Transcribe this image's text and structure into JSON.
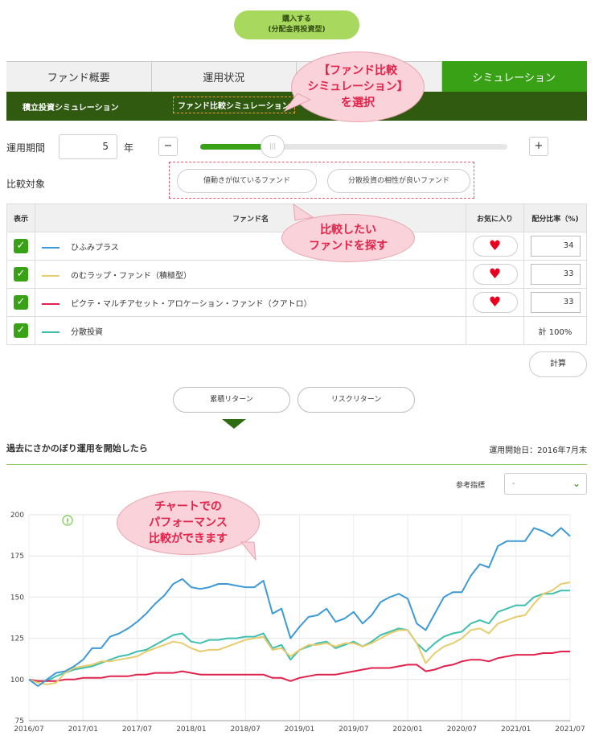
{
  "buy_button": {
    "line1": "購入する",
    "line2": "(分配金再投資型)"
  },
  "tabs": [
    {
      "label": "ファンド概要",
      "active": false
    },
    {
      "label": "運用状況",
      "active": false
    },
    {
      "label": "",
      "active": false
    },
    {
      "label": "シミュレーション",
      "active": true
    }
  ],
  "subtabs": [
    {
      "label": "積立投資シミュレーション",
      "selected": false
    },
    {
      "label": "ファンド比較シミュレーション",
      "selected": true
    }
  ],
  "callouts": {
    "select": [
      "【ファンド比較",
      "シミュレーション】",
      "を選択"
    ],
    "search": [
      "比較したい",
      "ファンドを探す"
    ],
    "chart": [
      "チャートでの",
      "パフォーマンス",
      "比較ができます"
    ]
  },
  "period": {
    "label": "運用期間",
    "value": "5",
    "unit": "年",
    "minus": "−",
    "plus": "+",
    "knob": "|||"
  },
  "compare": {
    "label": "比較対象",
    "buttons": [
      "値動きが似ているファンド",
      "分散投資の相性が良いファンド"
    ]
  },
  "table": {
    "headers": [
      "表示",
      "ファンド名",
      "お気に入り",
      "配分比率（%)"
    ],
    "rows": [
      {
        "name": "ひふみプラス",
        "color": "#3d9ad6",
        "fav": true,
        "ratio": "34"
      },
      {
        "name": "のむラップ・ファンド（積極型）",
        "color": "#e6cc6e",
        "fav": true,
        "ratio": "33"
      },
      {
        "name": "ピクテ・マルチアセット・アロケーション・ファンド（クアトロ）",
        "color": "#e0234d",
        "fav": true,
        "ratio": "33"
      },
      {
        "name": "分散投資",
        "color": "#3fbfb0",
        "fav": false,
        "ratio": ""
      }
    ],
    "total": "計  100%",
    "check": "✓",
    "heart": "♥"
  },
  "calc_button": "計算",
  "return_buttons": [
    "累積リターン",
    "リスクリターン"
  ],
  "section_title": "過去にさかのぼり運用を開始したら",
  "start_date": "運用開始日：2016年7月末",
  "ref": {
    "label": "参考指標",
    "value": "-",
    "chev": "⌄"
  },
  "chart_data": {
    "type": "line",
    "ylim": [
      75,
      200
    ],
    "y_ticks": [
      75,
      100,
      125,
      150,
      175,
      200
    ],
    "x_ticks": [
      "2016/07",
      "2017/01",
      "2017/07",
      "2018/01",
      "2018/07",
      "2019/01",
      "2019/07",
      "2020/01",
      "2020/07",
      "2021/01",
      "2021/07"
    ],
    "grid": true,
    "marker_label": "!",
    "series": [
      {
        "name": "ひふみプラス",
        "color": "#3d9ad6",
        "values": [
          100,
          96,
          100,
          104,
          105,
          108,
          112,
          119,
          119,
          126,
          128,
          131,
          135,
          140,
          146,
          151,
          158,
          161,
          156,
          155,
          156,
          158,
          158,
          157,
          156,
          156,
          160,
          140,
          143,
          125,
          132,
          138,
          139,
          143,
          135,
          137,
          141,
          134,
          139,
          147,
          150,
          152,
          149,
          134,
          130,
          140,
          150,
          153,
          153,
          163,
          170,
          168,
          181,
          184,
          184,
          184,
          192,
          190,
          187,
          192,
          187
        ]
      },
      {
        "name": "のむラップ・ファンド（積極型）",
        "color": "#e6cc6e",
        "values": [
          100,
          98,
          97,
          98,
          104,
          107,
          108,
          109,
          111,
          111,
          112,
          113,
          114,
          117,
          119,
          121,
          123,
          122,
          119,
          117,
          118,
          118,
          120,
          122,
          124,
          125,
          126,
          118,
          119,
          114,
          118,
          121,
          121,
          122,
          120,
          122,
          122,
          120,
          122,
          125,
          128,
          130,
          130,
          122,
          110,
          116,
          120,
          122,
          125,
          130,
          131,
          128,
          134,
          136,
          138,
          139,
          146,
          152,
          154,
          158,
          159
        ]
      },
      {
        "name": "ピクテ・マルチアセット・アロケーション・ファンド（クアトロ）",
        "color": "#e0234d",
        "values": [
          100,
          99,
          99,
          99,
          100,
          100,
          101,
          101,
          101,
          102,
          102,
          102,
          103,
          103,
          104,
          104,
          104,
          105,
          104,
          103,
          103,
          103,
          103,
          103,
          103,
          103,
          103,
          101,
          101,
          99,
          101,
          102,
          103,
          103,
          103,
          104,
          105,
          106,
          107,
          107,
          107,
          108,
          109,
          109,
          105,
          106,
          108,
          109,
          111,
          112,
          112,
          111,
          113,
          114,
          115,
          115,
          115,
          116,
          116,
          117,
          117
        ]
      },
      {
        "name": "分散投資",
        "color": "#3fbfb0",
        "values": [
          100,
          99,
          99,
          102,
          104,
          106,
          107,
          108,
          110,
          112,
          114,
          115,
          117,
          118,
          121,
          124,
          127,
          128,
          123,
          122,
          124,
          124,
          125,
          125,
          126,
          126,
          128,
          119,
          121,
          112,
          118,
          120,
          122,
          123,
          119,
          121,
          123,
          120,
          123,
          127,
          129,
          131,
          130,
          122,
          117,
          122,
          126,
          128,
          129,
          134,
          136,
          134,
          141,
          143,
          145,
          145,
          150,
          152,
          152,
          154,
          154
        ]
      }
    ]
  }
}
